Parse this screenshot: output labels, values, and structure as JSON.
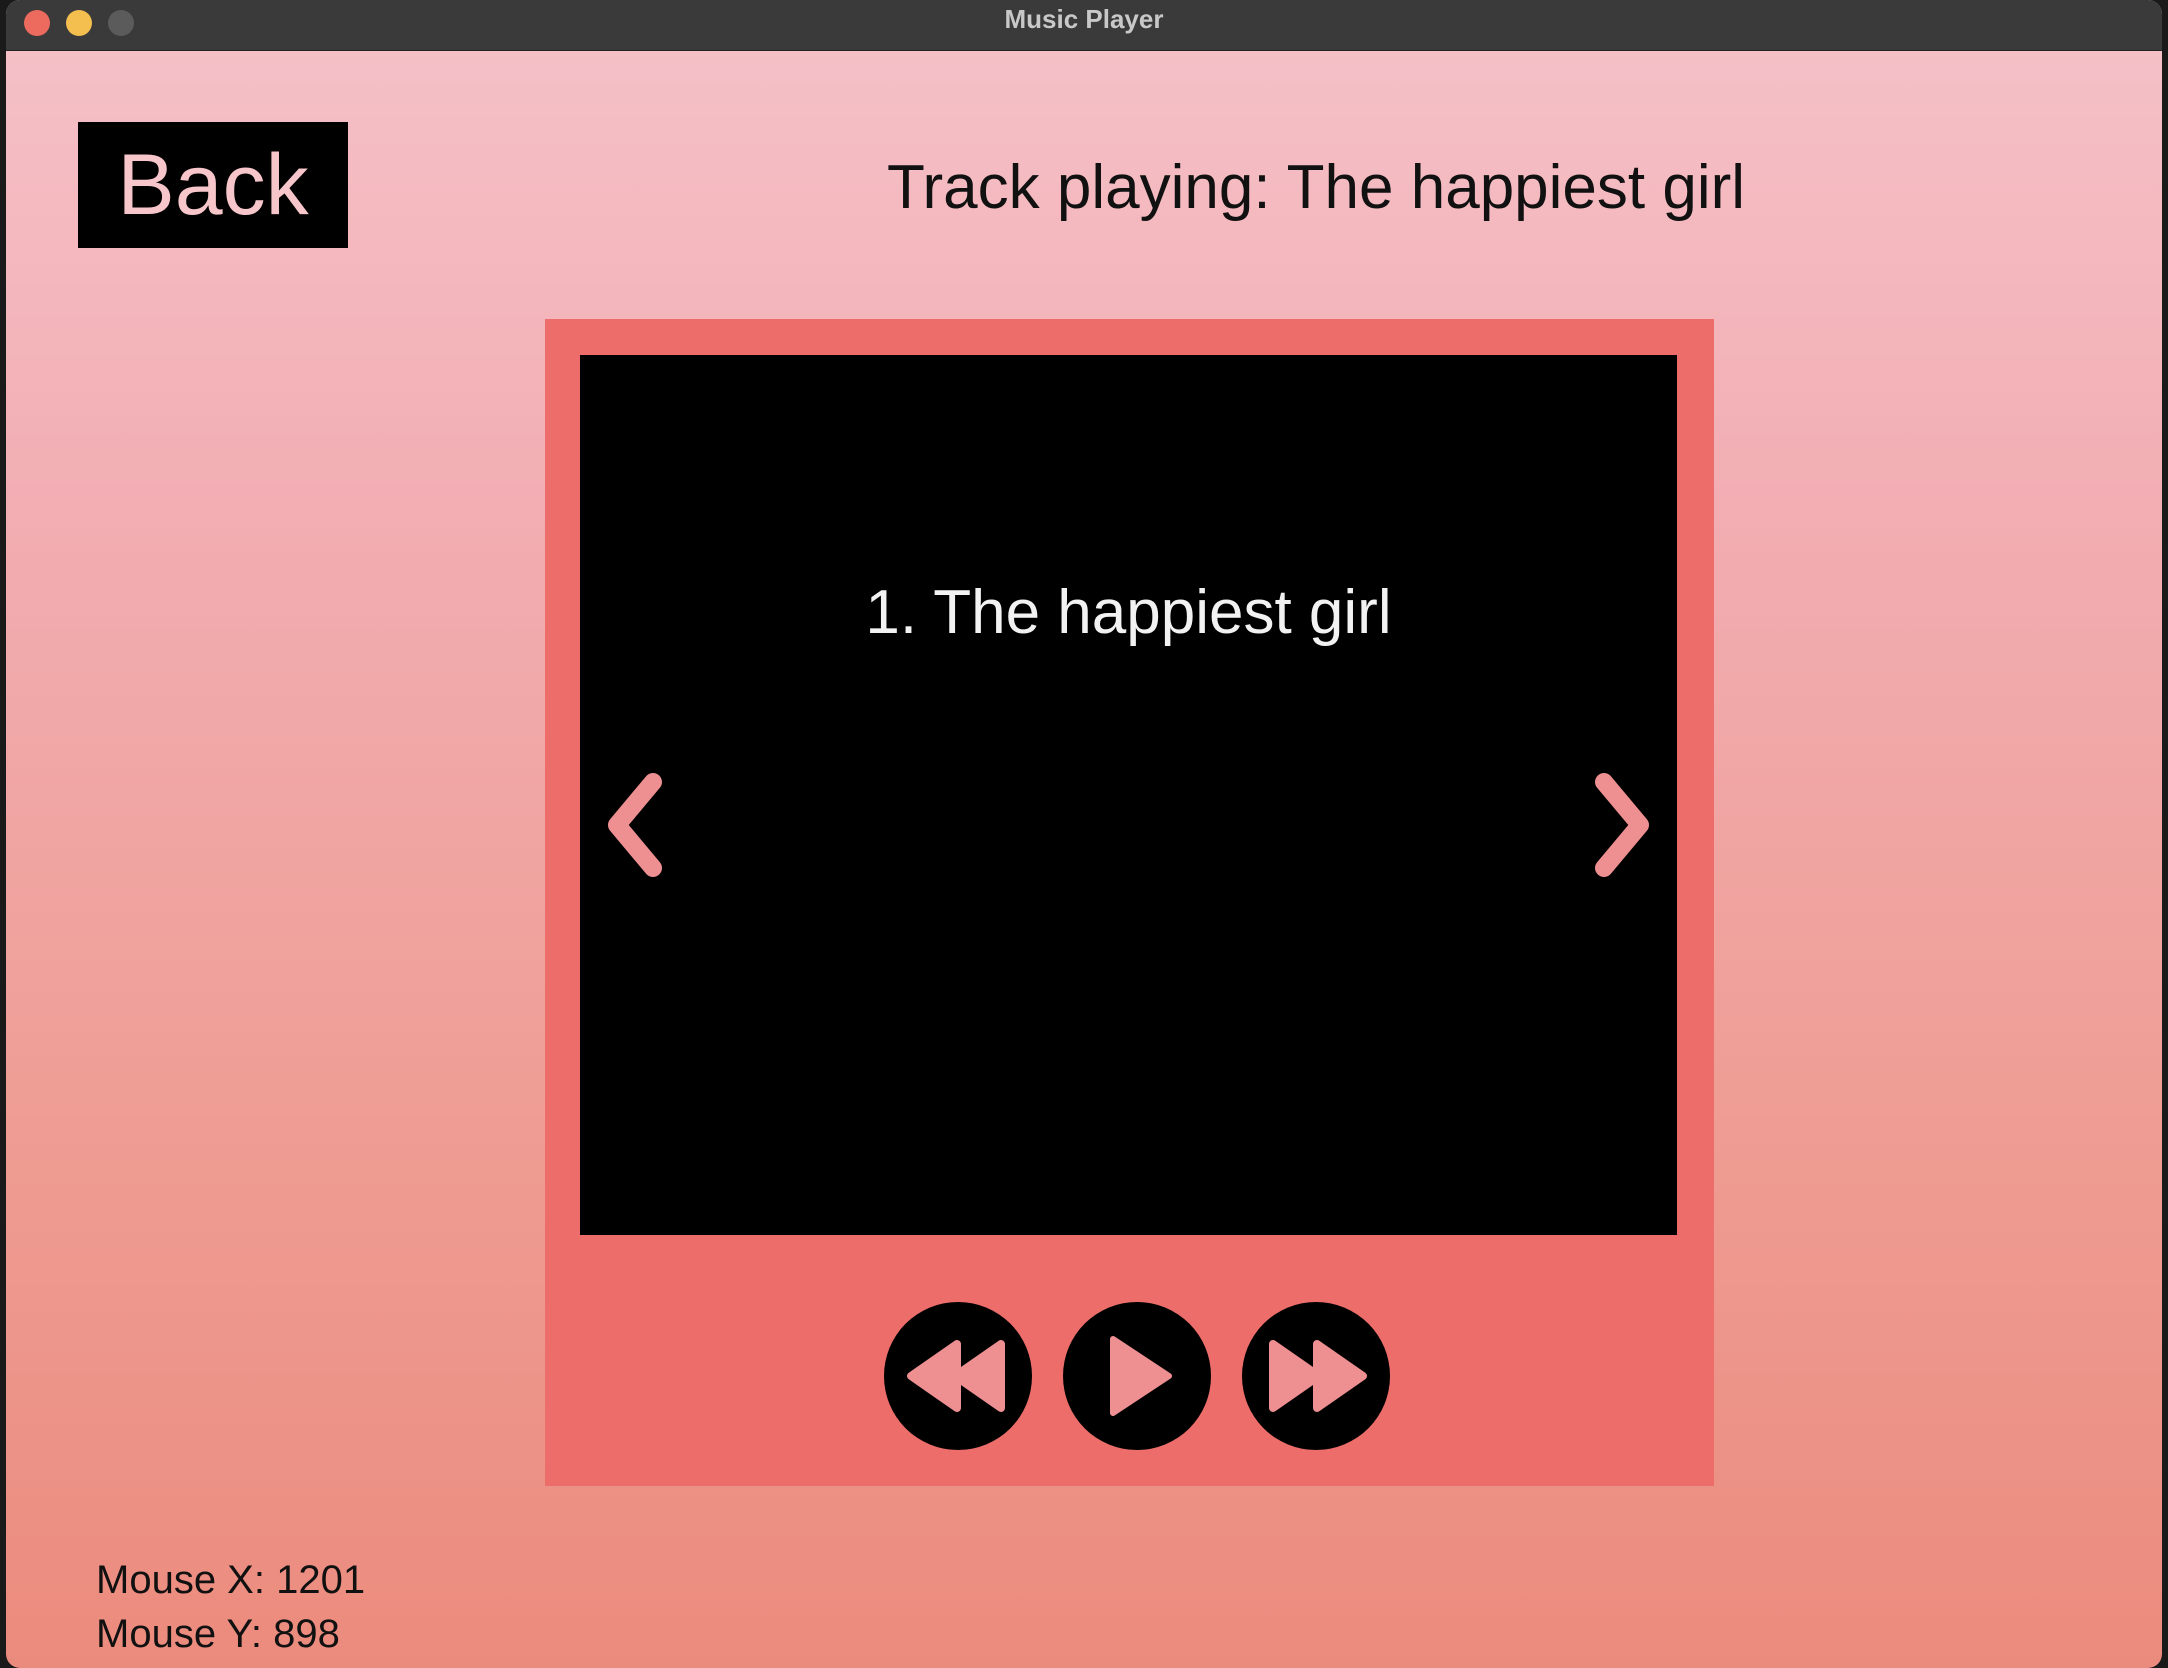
{
  "window": {
    "title": "Music Player"
  },
  "back_button": {
    "label": "Back"
  },
  "now_playing": {
    "text": "Track playing: The happiest girl"
  },
  "playlist": {
    "current_item": "1. The happiest girl"
  },
  "controls": {
    "rewind_icon": "rewind-icon",
    "play_icon": "play-icon",
    "fast_forward_icon": "fast-forward-icon",
    "prev_icon": "chevron-left-icon",
    "next_icon": "chevron-right-icon"
  },
  "debug": {
    "mouse_x": "Mouse X: 1201",
    "mouse_y": "Mouse Y: 898"
  },
  "colors": {
    "frame": "#ec6d69",
    "accent": "#ee8f92",
    "background_top": "#f5c2c9",
    "background_bottom": "#eb8b7d"
  }
}
